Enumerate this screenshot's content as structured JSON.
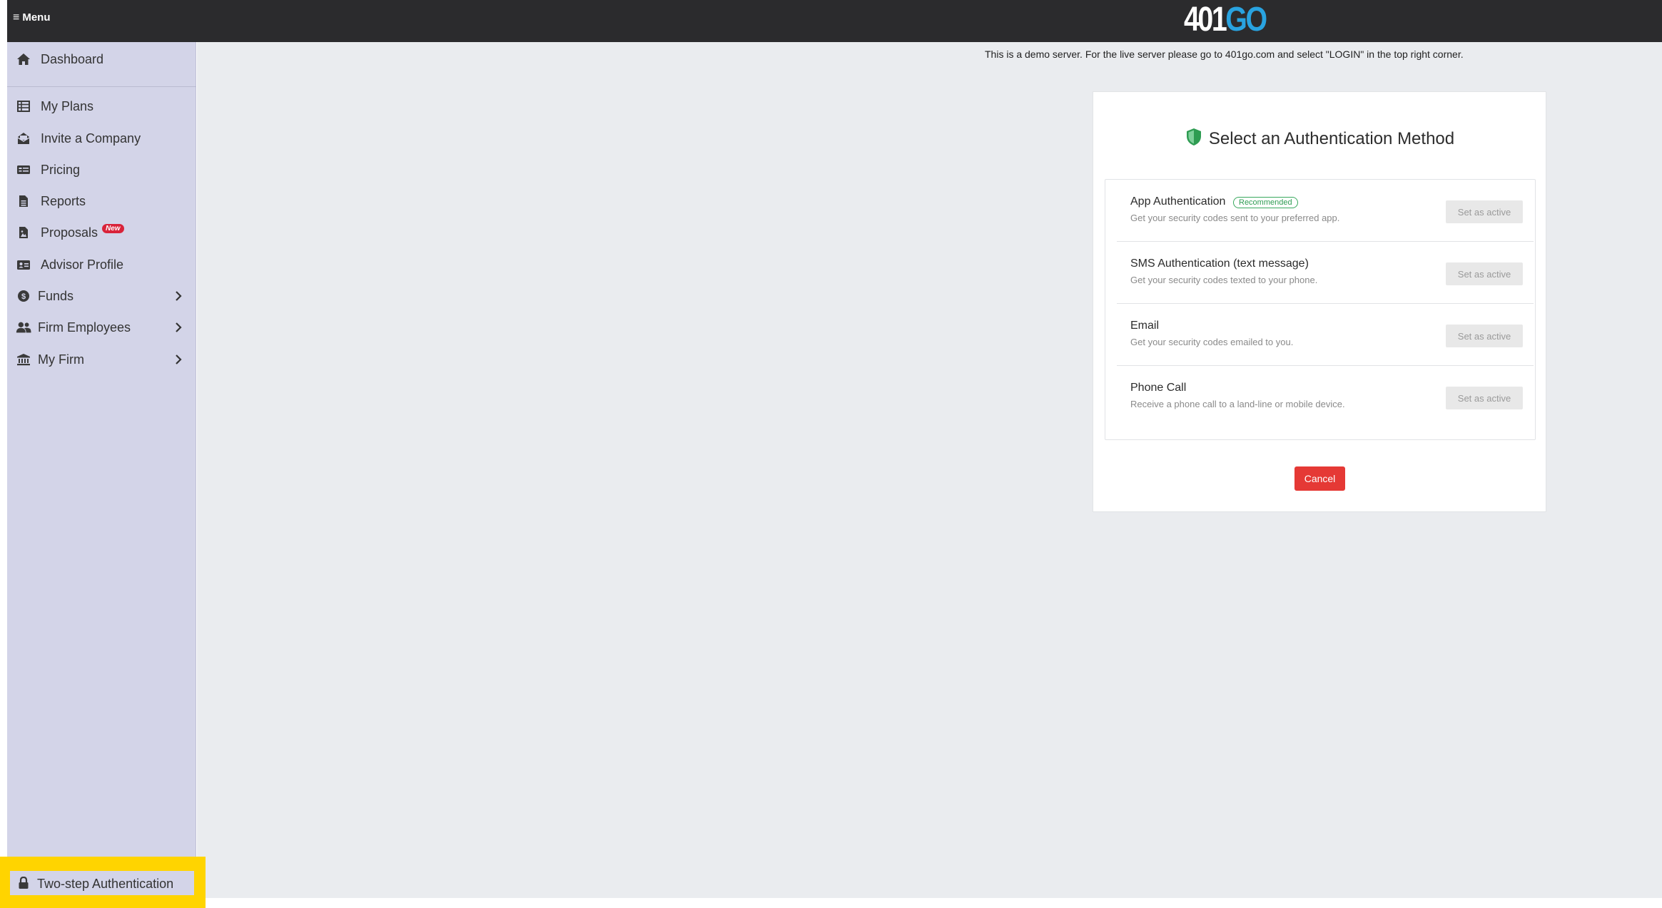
{
  "topbar": {
    "menu_label": "Menu",
    "logo_text_white": "401",
    "logo_text_blue": "GO"
  },
  "sidebar": {
    "items": [
      {
        "label": "Dashboard",
        "icon": "home-icon"
      },
      {
        "label": "My Plans",
        "icon": "table-list-icon"
      },
      {
        "label": "Invite a Company",
        "icon": "envelope-open-icon"
      },
      {
        "label": "Pricing",
        "icon": "money-check-icon"
      },
      {
        "label": "Reports",
        "icon": "file-icon"
      },
      {
        "label": "Proposals",
        "icon": "file-image-icon",
        "badge": "New"
      },
      {
        "label": "Advisor Profile",
        "icon": "id-card-icon"
      },
      {
        "label": "Funds",
        "icon": "money-bag-icon",
        "has_submenu": true
      },
      {
        "label": "Firm Employees",
        "icon": "users-icon",
        "has_submenu": true
      },
      {
        "label": "My Firm",
        "icon": "bank-icon",
        "has_submenu": true
      }
    ],
    "bottom_item": {
      "label": "Two-step Authentication",
      "icon": "lock-icon"
    }
  },
  "main": {
    "demo_note": "This is a demo server. For the live server please go to 401go.com and select \"LOGIN\" in the top right corner.",
    "card": {
      "title": "Select an Authentication Method",
      "methods": [
        {
          "name": "App Authentication",
          "badge": "Recommended",
          "desc": "Get your security codes sent to your preferred app.",
          "button": "Set as active"
        },
        {
          "name": "SMS Authentication (text message)",
          "desc": "Get your security codes texted to your phone.",
          "button": "Set as active"
        },
        {
          "name": "Email",
          "desc": "Get your security codes emailed to you.",
          "button": "Set as active"
        },
        {
          "name": "Phone Call",
          "desc": "Receive a phone call to a land-line or mobile device.",
          "button": "Set as active"
        }
      ],
      "cancel_label": "Cancel"
    }
  },
  "colors": {
    "topbar_bg": "#2b2b2d",
    "sidebar_bg": "#d3d4e8",
    "highlight": "#ffd400",
    "cancel_bg": "#e53935",
    "shield_green": "#2e9c52",
    "logo_blue": "#29a3e0"
  }
}
